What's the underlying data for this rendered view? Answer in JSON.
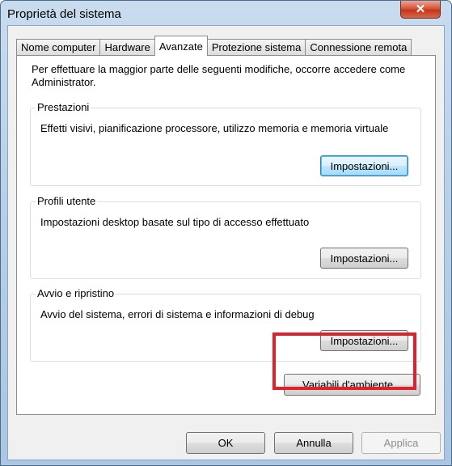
{
  "window": {
    "title": "Proprietà del sistema"
  },
  "titlebar": {
    "close_glyph": "✕"
  },
  "tabs": [
    {
      "label": "Nome computer"
    },
    {
      "label": "Hardware"
    },
    {
      "label": "Avanzate"
    },
    {
      "label": "Protezione sistema"
    },
    {
      "label": "Connessione remota"
    }
  ],
  "intro_text": "Per effettuare la maggior parte delle seguenti modifiche, occorre accedere come Administrator.",
  "groups": [
    {
      "label": "Prestazioni",
      "description": "Effetti visivi, pianificazione processore, utilizzo memoria e memoria virtuale",
      "button": "Impostazioni..."
    },
    {
      "label": "Profili utente",
      "description": "Impostazioni desktop basate sul tipo di accesso effettuato",
      "button": "Impostazioni..."
    },
    {
      "label": "Avvio e ripristino",
      "description": "Avvio del sistema, errori di sistema e informazioni di debug",
      "button": "Impostazioni..."
    }
  ],
  "env_button": "Variabili d'ambiente...",
  "footer": {
    "ok": "OK",
    "cancel": "Annulla",
    "apply": "Applica"
  },
  "colors": {
    "highlight": "#e0202a",
    "close": "#c2361c"
  }
}
